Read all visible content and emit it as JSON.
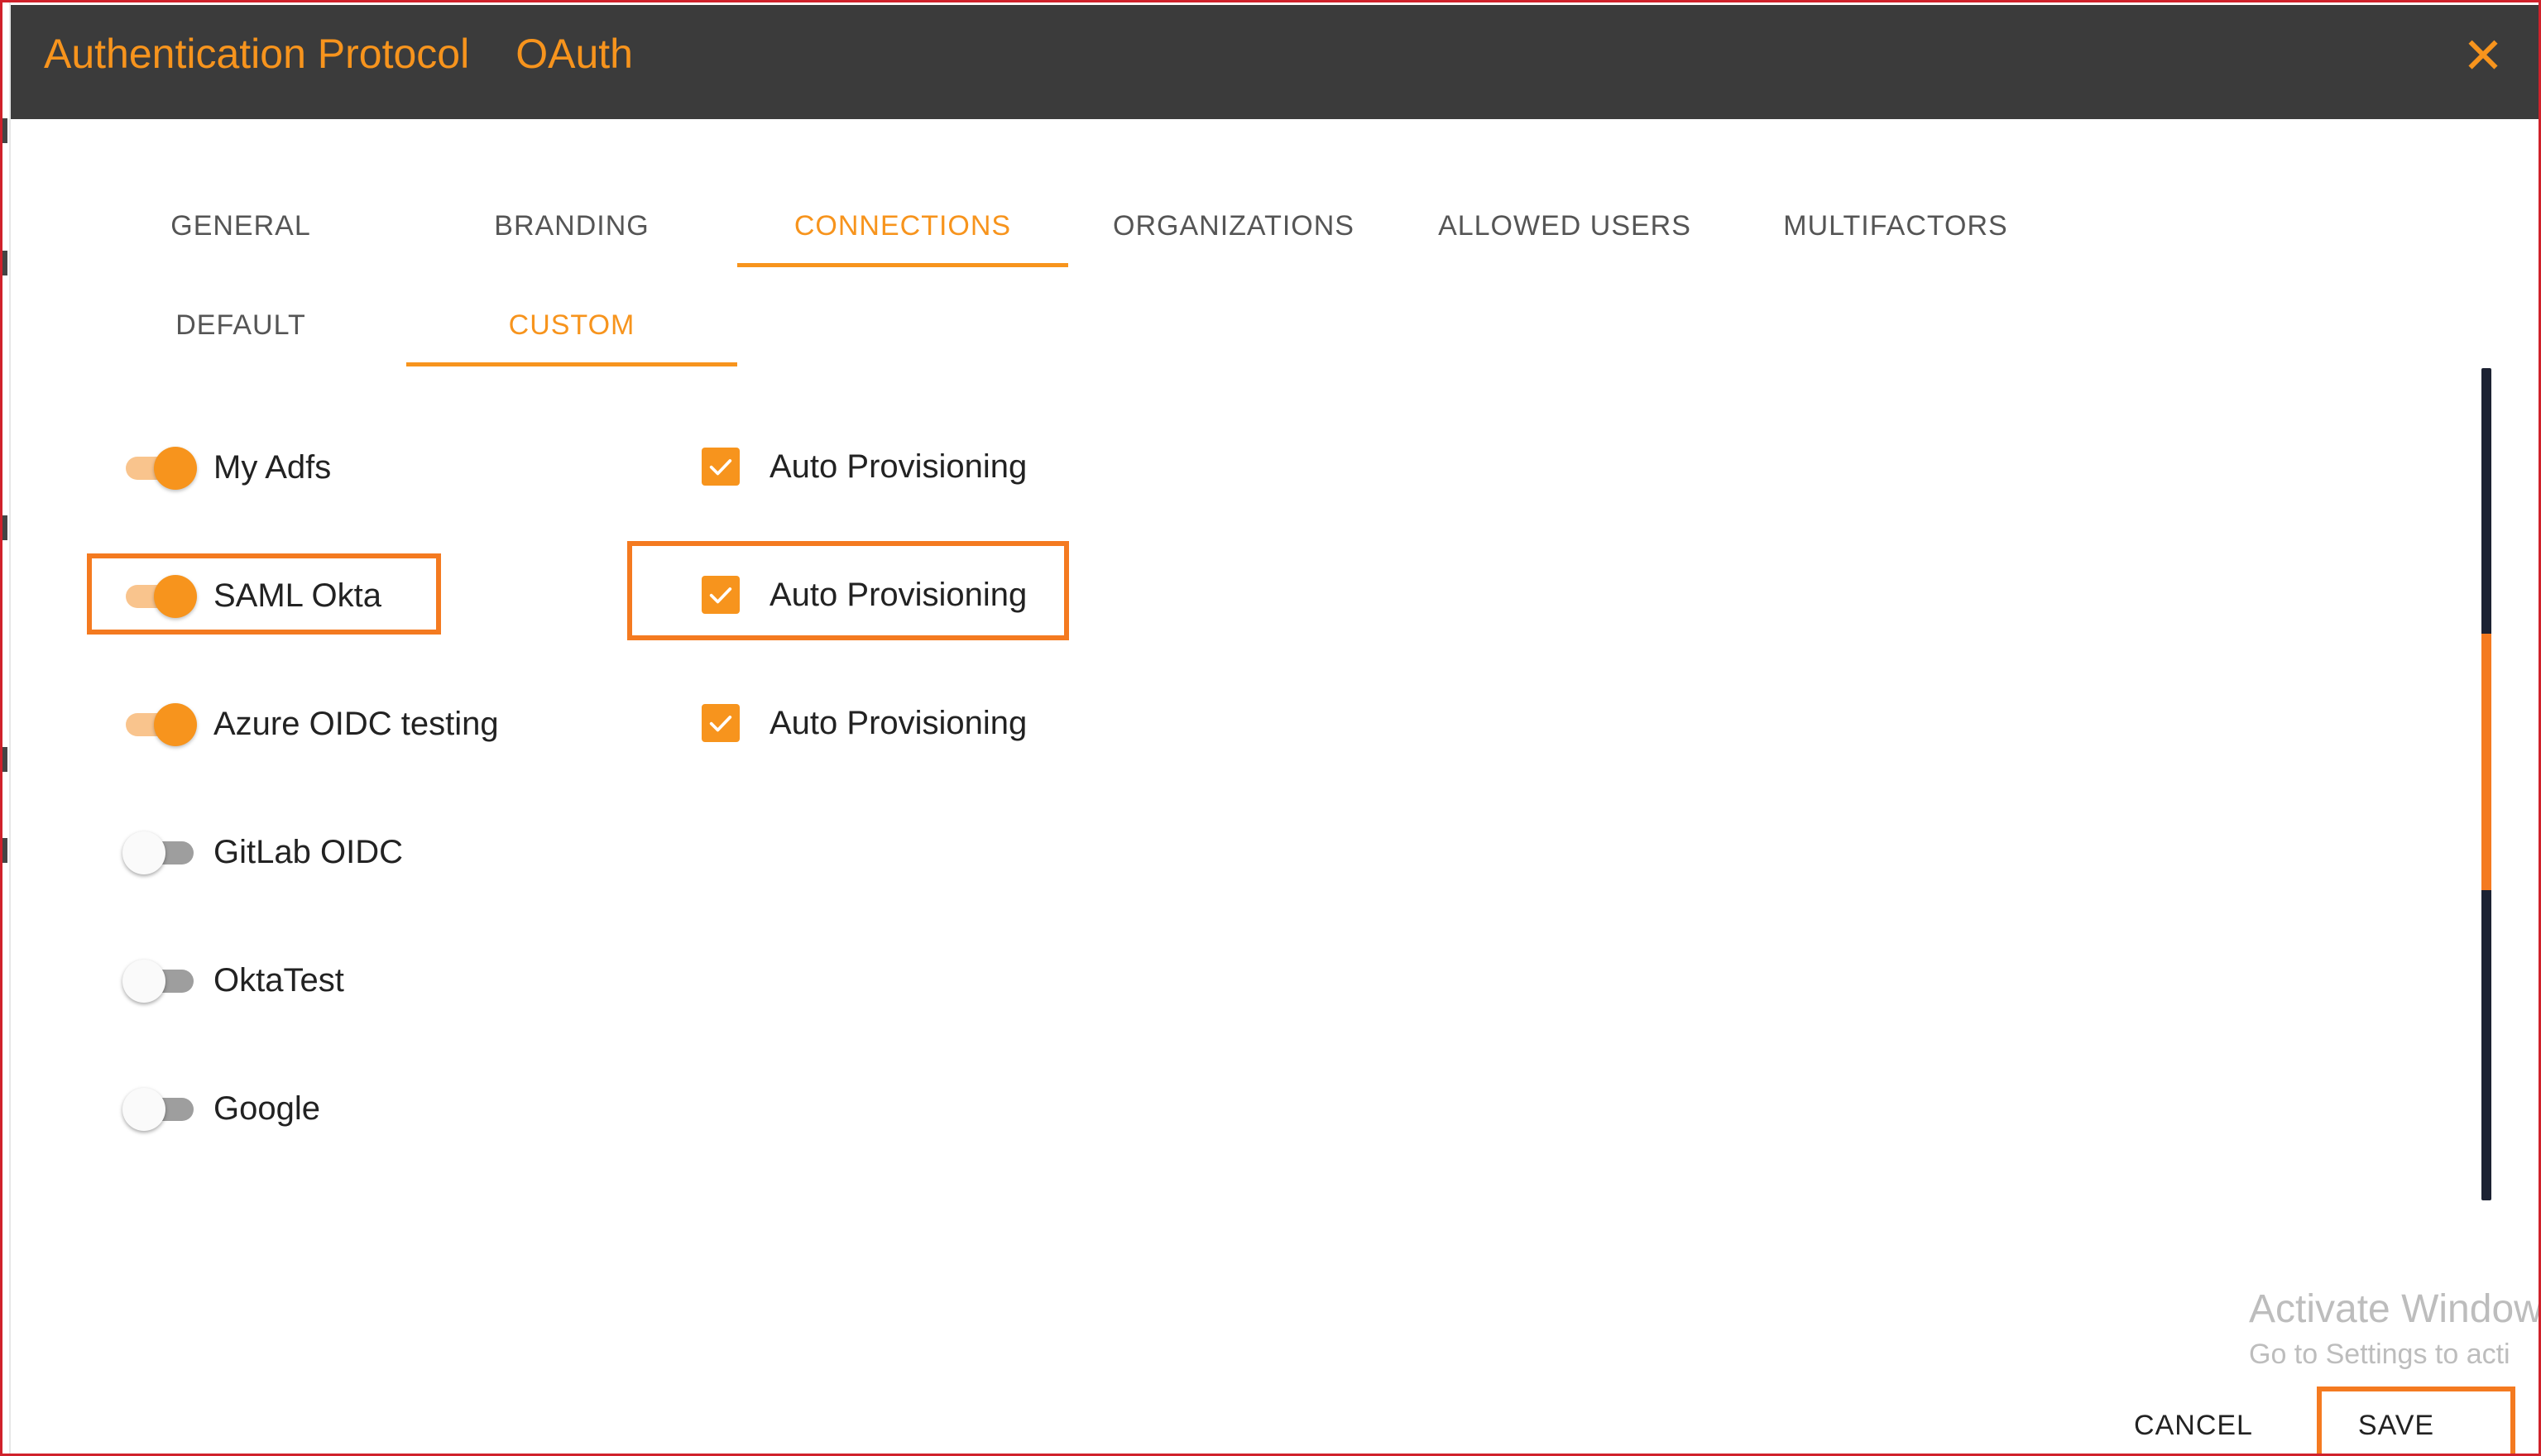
{
  "dialog": {
    "title_prefix": "Authentication Protocol",
    "protocol": "OAuth",
    "close_symbol": "✕"
  },
  "tabs": [
    {
      "label": "GENERAL",
      "active": false
    },
    {
      "label": "BRANDING",
      "active": false
    },
    {
      "label": "CONNECTIONS",
      "active": true
    },
    {
      "label": "ORGANIZATIONS",
      "active": false
    },
    {
      "label": "ALLOWED USERS",
      "active": false
    },
    {
      "label": "MULTIFACTORS",
      "active": false
    }
  ],
  "subtabs": [
    {
      "label": "DEFAULT",
      "active": false
    },
    {
      "label": "CUSTOM",
      "active": true
    }
  ],
  "connections": [
    {
      "name": "My Adfs",
      "enabled": true,
      "auto_provisioning": true,
      "auto_provisioning_label": "Auto Provisioning"
    },
    {
      "name": "SAML Okta",
      "enabled": true,
      "auto_provisioning": true,
      "auto_provisioning_label": "Auto Provisioning"
    },
    {
      "name": "Azure OIDC testing",
      "enabled": true,
      "auto_provisioning": true,
      "auto_provisioning_label": "Auto Provisioning"
    },
    {
      "name": "GitLab OIDC",
      "enabled": false
    },
    {
      "name": "OktaTest",
      "enabled": false
    },
    {
      "name": "Google",
      "enabled": false
    }
  ],
  "watermark": {
    "line1": "Activate Window",
    "line2": "Go to Settings to acti"
  },
  "footer": {
    "cancel_label": "CANCEL",
    "save_label": "SAVE"
  },
  "colors": {
    "accent": "#f7941d",
    "highlight": "#f47a20",
    "header_bg": "#3b3b3b",
    "frame_border": "#d0212b"
  }
}
